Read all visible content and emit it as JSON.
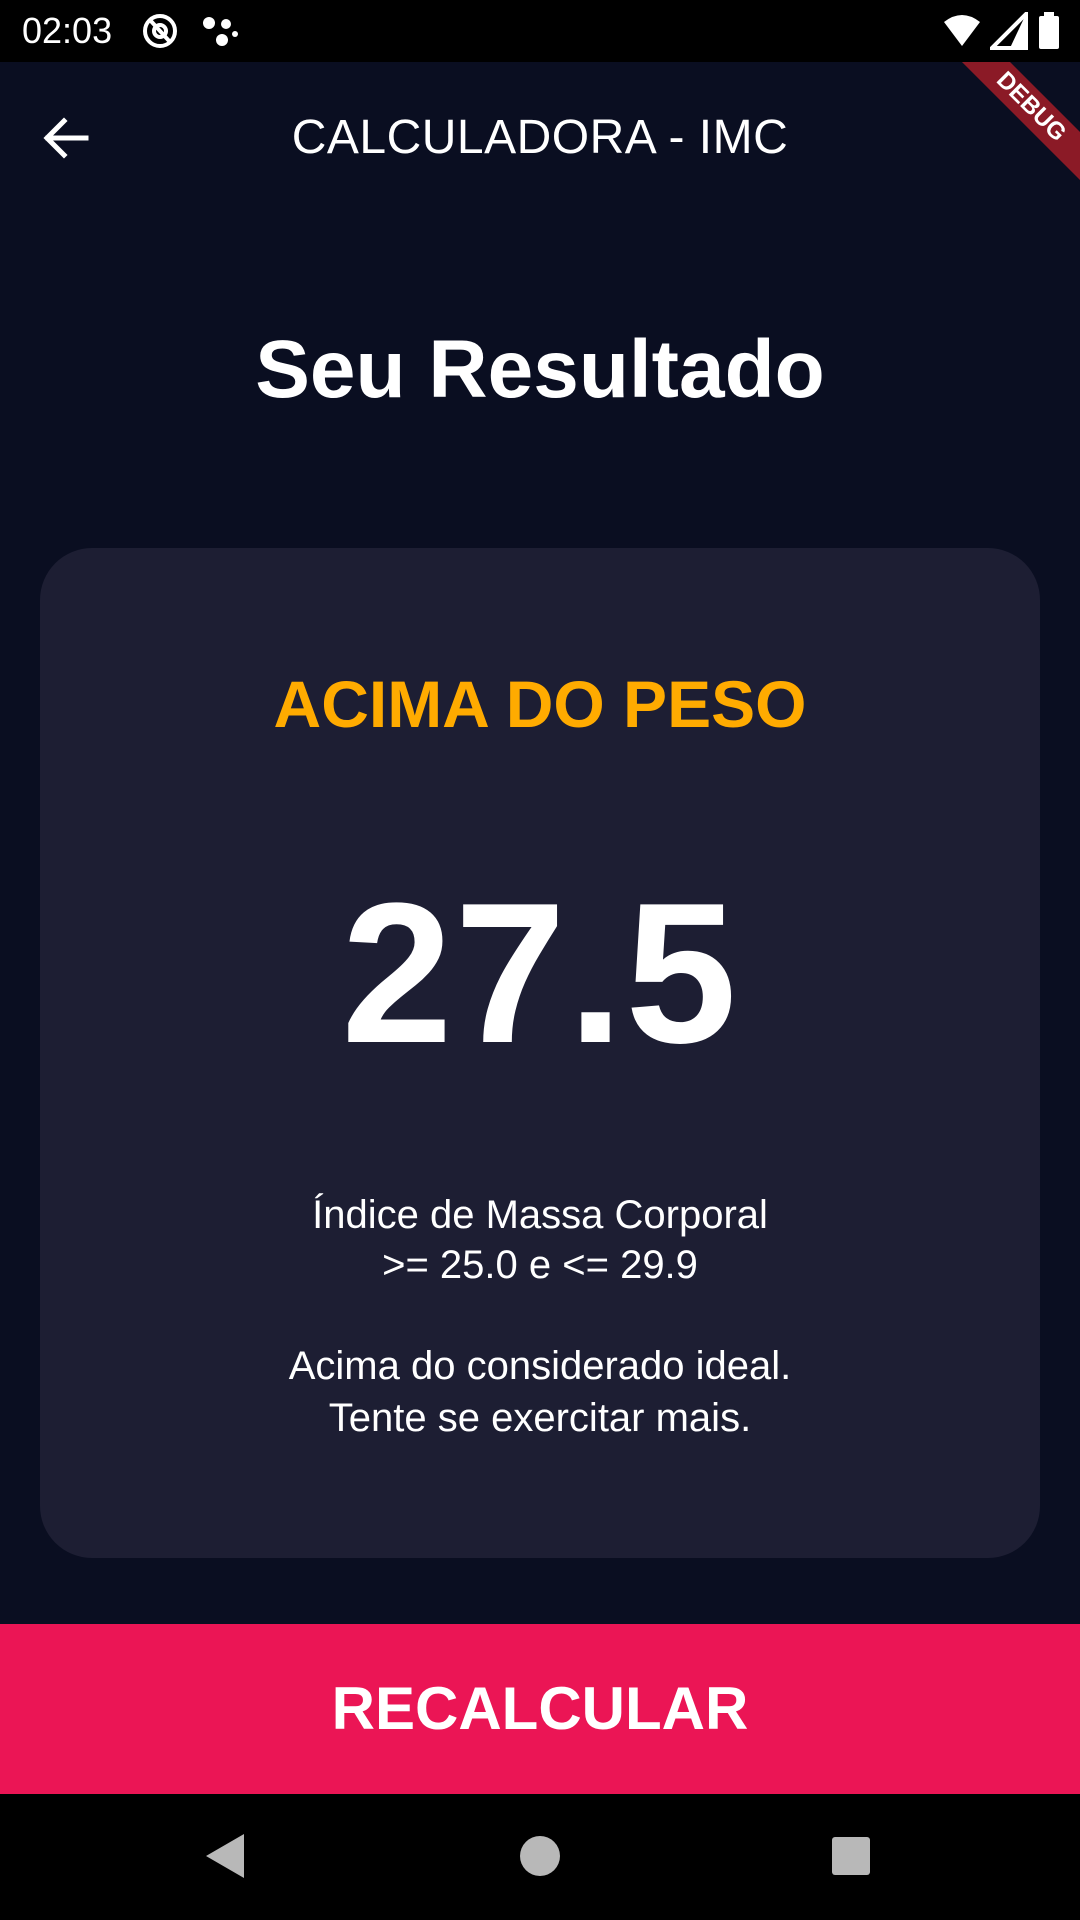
{
  "status_bar": {
    "time": "02:03",
    "icons": [
      "at-sign-icon",
      "dots-icon",
      "wifi-icon",
      "signal-icon",
      "battery-icon"
    ]
  },
  "app_bar": {
    "title": "CALCULADORA - IMC",
    "back_icon": "arrow-left-icon",
    "debug_banner": "DEBUG"
  },
  "result": {
    "heading": "Seu Resultado",
    "status": "ACIMA DO PESO",
    "value": "27.5",
    "range_line1": "Índice de Massa Corporal",
    "range_line2": ">= 25.0 e <= 29.9",
    "advice_line1": "Acima do considerado ideal.",
    "advice_line2": "Tente se exercitar mais."
  },
  "button": {
    "label": "RECALCULAR"
  },
  "nav_bar": {
    "icons": [
      "back-triangle-icon",
      "home-circle-icon",
      "recents-square-icon"
    ]
  },
  "colors": {
    "background": "#0a0e21",
    "card": "#1d1e33",
    "status_accent": "#ffab00",
    "button": "#eb1555"
  }
}
